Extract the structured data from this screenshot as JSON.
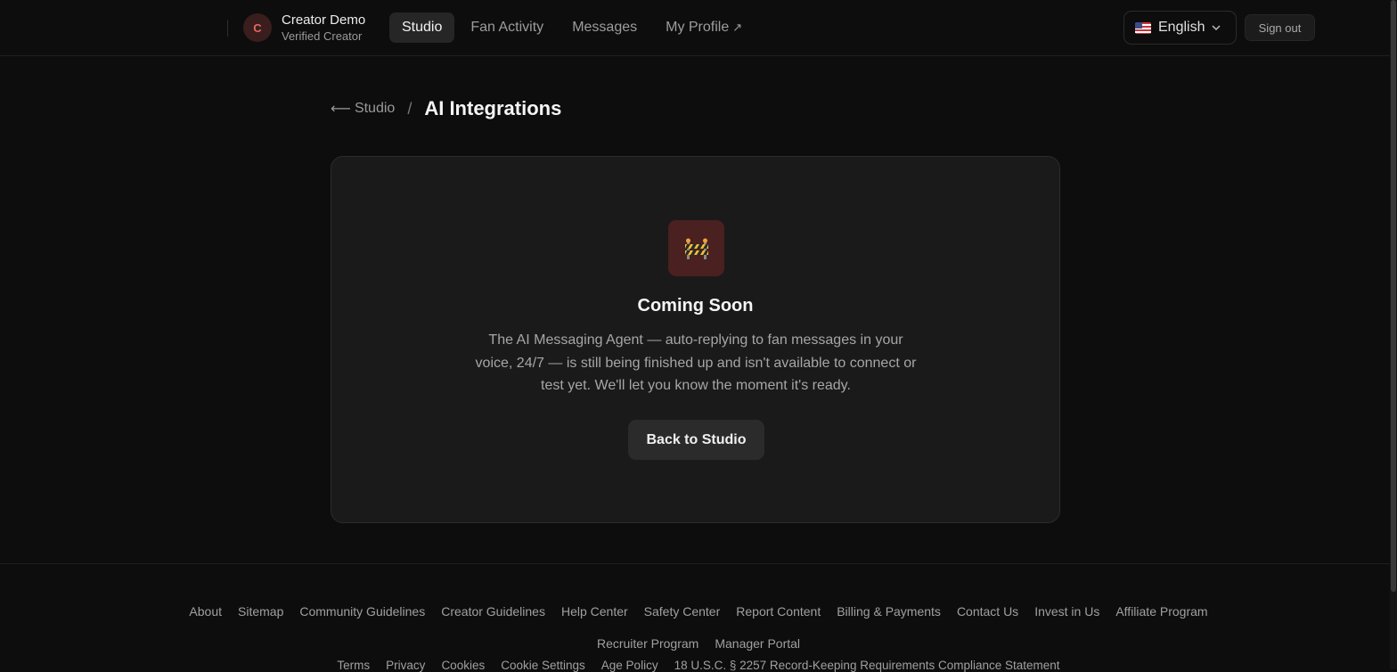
{
  "header": {
    "avatar_initial": "C",
    "creator_name": "Creator Demo",
    "creator_subtitle": "Verified Creator",
    "nav": [
      {
        "label": "Studio",
        "active": true
      },
      {
        "label": "Fan Activity",
        "active": false
      },
      {
        "label": "Messages",
        "active": false
      },
      {
        "label": "My Profile",
        "active": false,
        "external_icon": "↗"
      }
    ],
    "language": {
      "label": "English",
      "flag_icon": "us-flag-icon"
    },
    "sign_out_label": "Sign out"
  },
  "breadcrumb": {
    "back_arrow": "⟵",
    "back_label": "Studio",
    "separator": "/",
    "current": "AI Integrations"
  },
  "card": {
    "icon": "construction-barrier-icon",
    "title": "Coming Soon",
    "description": "The AI Messaging Agent — auto-replying to fan messages in your voice, 24/7 — is still being finished up and isn't available to connect or test yet. We'll let you know the moment it's ready.",
    "button_label": "Back to Studio"
  },
  "footer": {
    "row1": [
      "About",
      "Sitemap",
      "Community Guidelines",
      "Creator Guidelines",
      "Help Center",
      "Safety Center",
      "Report Content",
      "Billing & Payments",
      "Contact Us",
      "Invest in Us",
      "Affiliate Program"
    ],
    "row2": [
      "Recruiter Program",
      "Manager Portal"
    ],
    "row3": [
      "Terms",
      "Privacy",
      "Cookies",
      "Cookie Settings",
      "Age Policy",
      "18 U.S.C. § 2257 Record-Keeping Requirements Compliance Statement"
    ]
  },
  "colors": {
    "background": "#0d0d0d",
    "card": "#1a1a1a",
    "accent_avatar": "#e26a5e",
    "icon_box": "#4a2020"
  }
}
